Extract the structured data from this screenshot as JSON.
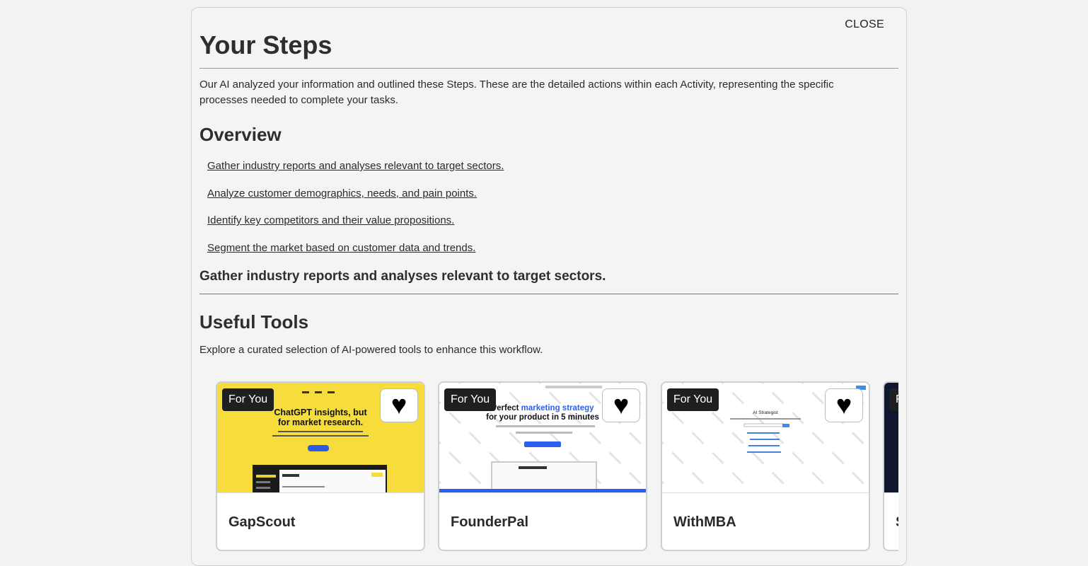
{
  "modal": {
    "close_label": "CLOSE",
    "title": "Your Steps",
    "intro": "Our AI analyzed your information and outlined these Steps. These are the detailed actions within each Activity, representing the specific processes needed to complete your tasks."
  },
  "overview": {
    "title": "Overview",
    "items": [
      "Gather industry reports and analyses relevant to target sectors.",
      "Analyze customer demographics, needs, and pain points.",
      "Identify key competitors and their value propositions.",
      "Segment the market based on customer data and trends."
    ]
  },
  "step": {
    "title": "Gather industry reports and analyses relevant to target sectors."
  },
  "tools": {
    "title": "Useful Tools",
    "description": "Explore a curated selection of AI-powered tools to enhance this workflow.",
    "cards": [
      {
        "name": "GapScout",
        "badge": "For You",
        "thumb_headline": "ChatGPT insights, but for market research.",
        "thumb_bg": "#f7dd3c"
      },
      {
        "name": "FounderPal",
        "badge": "For You",
        "thumb_headline_part1": "Perfect",
        "thumb_headline_accent": "marketing strategy",
        "thumb_headline_part2": "for your product in 5 minutes",
        "thumb_bg": "#ffffff"
      },
      {
        "name": "WithMBA",
        "badge": "For You",
        "thumb_headline": "AI Strategist",
        "thumb_bg": "#ffffff"
      },
      {
        "name": "S",
        "badge": "F",
        "thumb_bg": "#0f1730"
      }
    ]
  },
  "icons": {
    "favorite": "heart-icon"
  }
}
